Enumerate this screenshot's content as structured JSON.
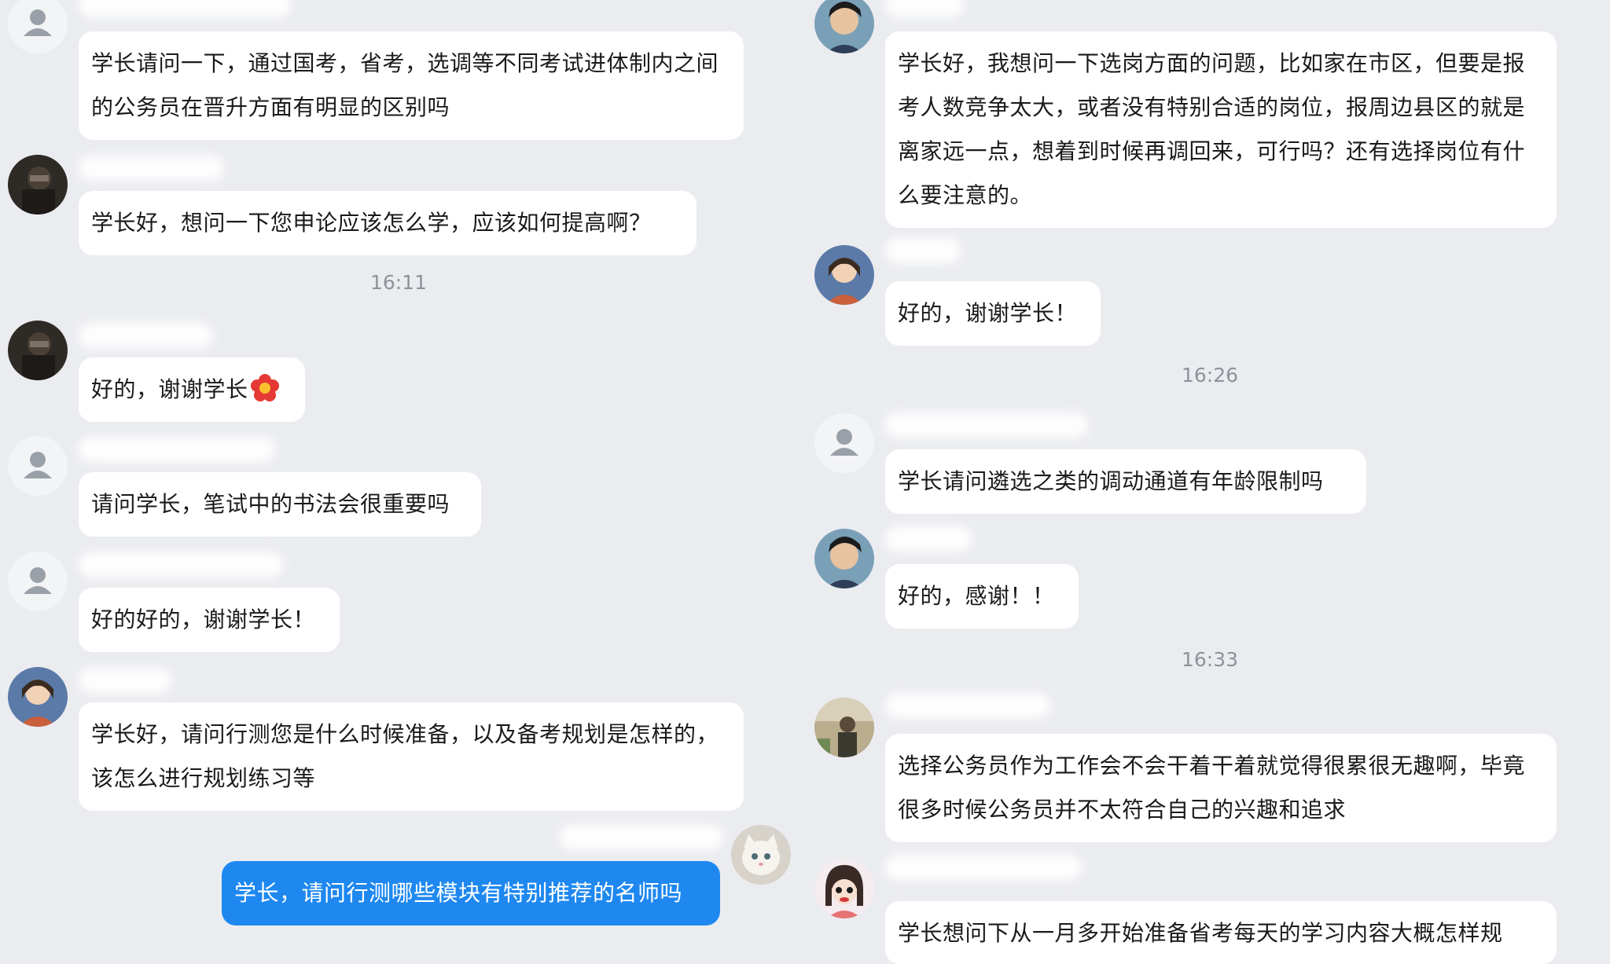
{
  "left_column": {
    "messages": [
      {
        "avatar": "default-avatar-icon",
        "text": "学长请问一下，通过国考，省考，选调等不同考试进体制内之间的公务员在晋升方面有明显的区别吗"
      },
      {
        "avatar": "photo-avatar-dark",
        "text": "学长好，想问一下您申论应该怎么学，应该如何提高啊？"
      },
      {
        "timestamp": "16:11"
      },
      {
        "avatar": "photo-avatar-dark",
        "text": "好的，谢谢学长",
        "emoji": "red-flower-emoji"
      },
      {
        "avatar": "default-avatar-icon",
        "text": "请问学长，笔试中的书法会很重要吗"
      },
      {
        "avatar": "default-avatar-icon",
        "text": "好的好的，谢谢学长！"
      },
      {
        "avatar": "anime-avatar",
        "text": "学长好，请问行测您是什么时候准备，以及备考规划是怎样的，该怎么进行规划练习等"
      },
      {
        "avatar": "cat-avatar",
        "self": true,
        "text": "学长，请问行测哪些模块有特别推荐的名师吗"
      }
    ]
  },
  "right_column": {
    "messages": [
      {
        "avatar": "person-avatar",
        "text": "学长好，我想问一下选岗方面的问题，比如家在市区，但要是报考人数竞争太大，或者没有特别合适的岗位，报周边县区的就是离家远一点，想着到时候再调回来，可行吗？还有选择岗位有什么要注意的。"
      },
      {
        "avatar": "anime-avatar",
        "text": "好的，谢谢学长！"
      },
      {
        "timestamp": "16:26"
      },
      {
        "avatar": "default-avatar-icon",
        "text": "学长请问遴选之类的调动通道有年龄限制吗"
      },
      {
        "avatar": "person-avatar",
        "text": "好的，感谢！！"
      },
      {
        "timestamp": "16:33"
      },
      {
        "avatar": "photo-avatar-outdoor",
        "text": "选择公务员作为工作会不会干着干着就觉得很累很无趣啊，毕竟很多时候公务员并不太符合自己的兴趣和追求"
      },
      {
        "avatar": "cartoon-girl-avatar",
        "text": "学长想问下从一月多开始准备省考每天的学习内容大概怎样规"
      }
    ]
  },
  "colors": {
    "background": "#ebecf0",
    "bubble": "#ffffff",
    "self_bubble": "#1e88f0",
    "timestamp_text": "#8e929a"
  }
}
